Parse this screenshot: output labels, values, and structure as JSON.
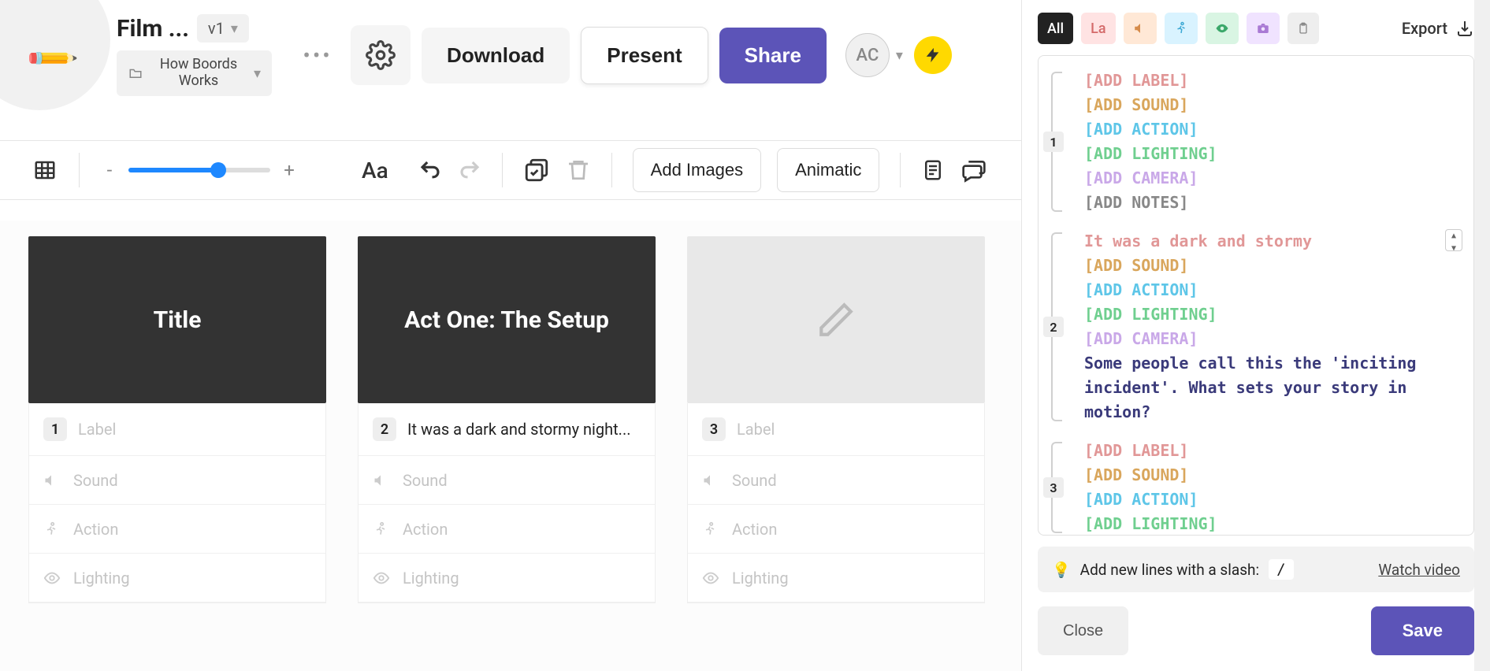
{
  "header": {
    "project_title": "Film ...",
    "version": "v1",
    "folder": "How Boords Works",
    "download": "Download",
    "present": "Present",
    "share": "Share",
    "avatar_initials": "AC"
  },
  "toolbar": {
    "add_images": "Add Images",
    "animatic": "Animatic",
    "zoom_minus": "-",
    "zoom_plus": "+",
    "font_label": "Aa"
  },
  "cards": [
    {
      "number": "1",
      "image_title": "Title",
      "label": "",
      "sound": "",
      "action": "",
      "lighting": "",
      "placeholders": {
        "label": "Label",
        "sound": "Sound",
        "action": "Action",
        "lighting": "Lighting"
      }
    },
    {
      "number": "2",
      "image_title": "Act One: The Setup",
      "label": "It was a dark and stormy night...",
      "sound": "",
      "action": "",
      "lighting": "",
      "placeholders": {
        "label": "Label",
        "sound": "Sound",
        "action": "Action",
        "lighting": "Lighting"
      }
    },
    {
      "number": "3",
      "image_title": "",
      "label": "",
      "sound": "",
      "action": "",
      "lighting": "",
      "placeholders": {
        "label": "Label",
        "sound": "Sound",
        "action": "Action",
        "lighting": "Lighting"
      }
    }
  ],
  "side": {
    "filters": {
      "all": "All",
      "la": "La"
    },
    "export": "Export",
    "tip_text": "Add new lines with a slash:",
    "tip_key": "/",
    "watch": "Watch video",
    "close": "Close",
    "save": "Save",
    "rows": [
      {
        "num": "1",
        "lines": [
          {
            "cls": "c-label",
            "t": "[ADD LABEL]"
          },
          {
            "cls": "c-sound",
            "t": "[ADD SOUND]"
          },
          {
            "cls": "c-action",
            "t": "[ADD ACTION]"
          },
          {
            "cls": "c-light",
            "t": "[ADD LIGHTING]"
          },
          {
            "cls": "c-camera",
            "t": "[ADD CAMERA]"
          },
          {
            "cls": "c-notes",
            "t": "[ADD NOTES]"
          }
        ],
        "stepper": false
      },
      {
        "num": "2",
        "lines": [
          {
            "cls": "c-label",
            "t": "It was a dark and stormy"
          },
          {
            "cls": "c-sound",
            "t": "[ADD SOUND]"
          },
          {
            "cls": "c-action",
            "t": "[ADD ACTION]"
          },
          {
            "cls": "c-light",
            "t": "[ADD LIGHTING]"
          },
          {
            "cls": "c-camera",
            "t": "[ADD CAMERA]"
          },
          {
            "cls": "c-text",
            "t": "Some people call this the 'inciting incident'. What sets your story in motion?"
          }
        ],
        "stepper": true
      },
      {
        "num": "3",
        "lines": [
          {
            "cls": "c-label",
            "t": "[ADD LABEL]"
          },
          {
            "cls": "c-sound",
            "t": "[ADD SOUND]"
          },
          {
            "cls": "c-action",
            "t": "[ADD ACTION]"
          },
          {
            "cls": "c-light",
            "t": "[ADD LIGHTING]"
          }
        ],
        "stepper": false
      }
    ]
  }
}
